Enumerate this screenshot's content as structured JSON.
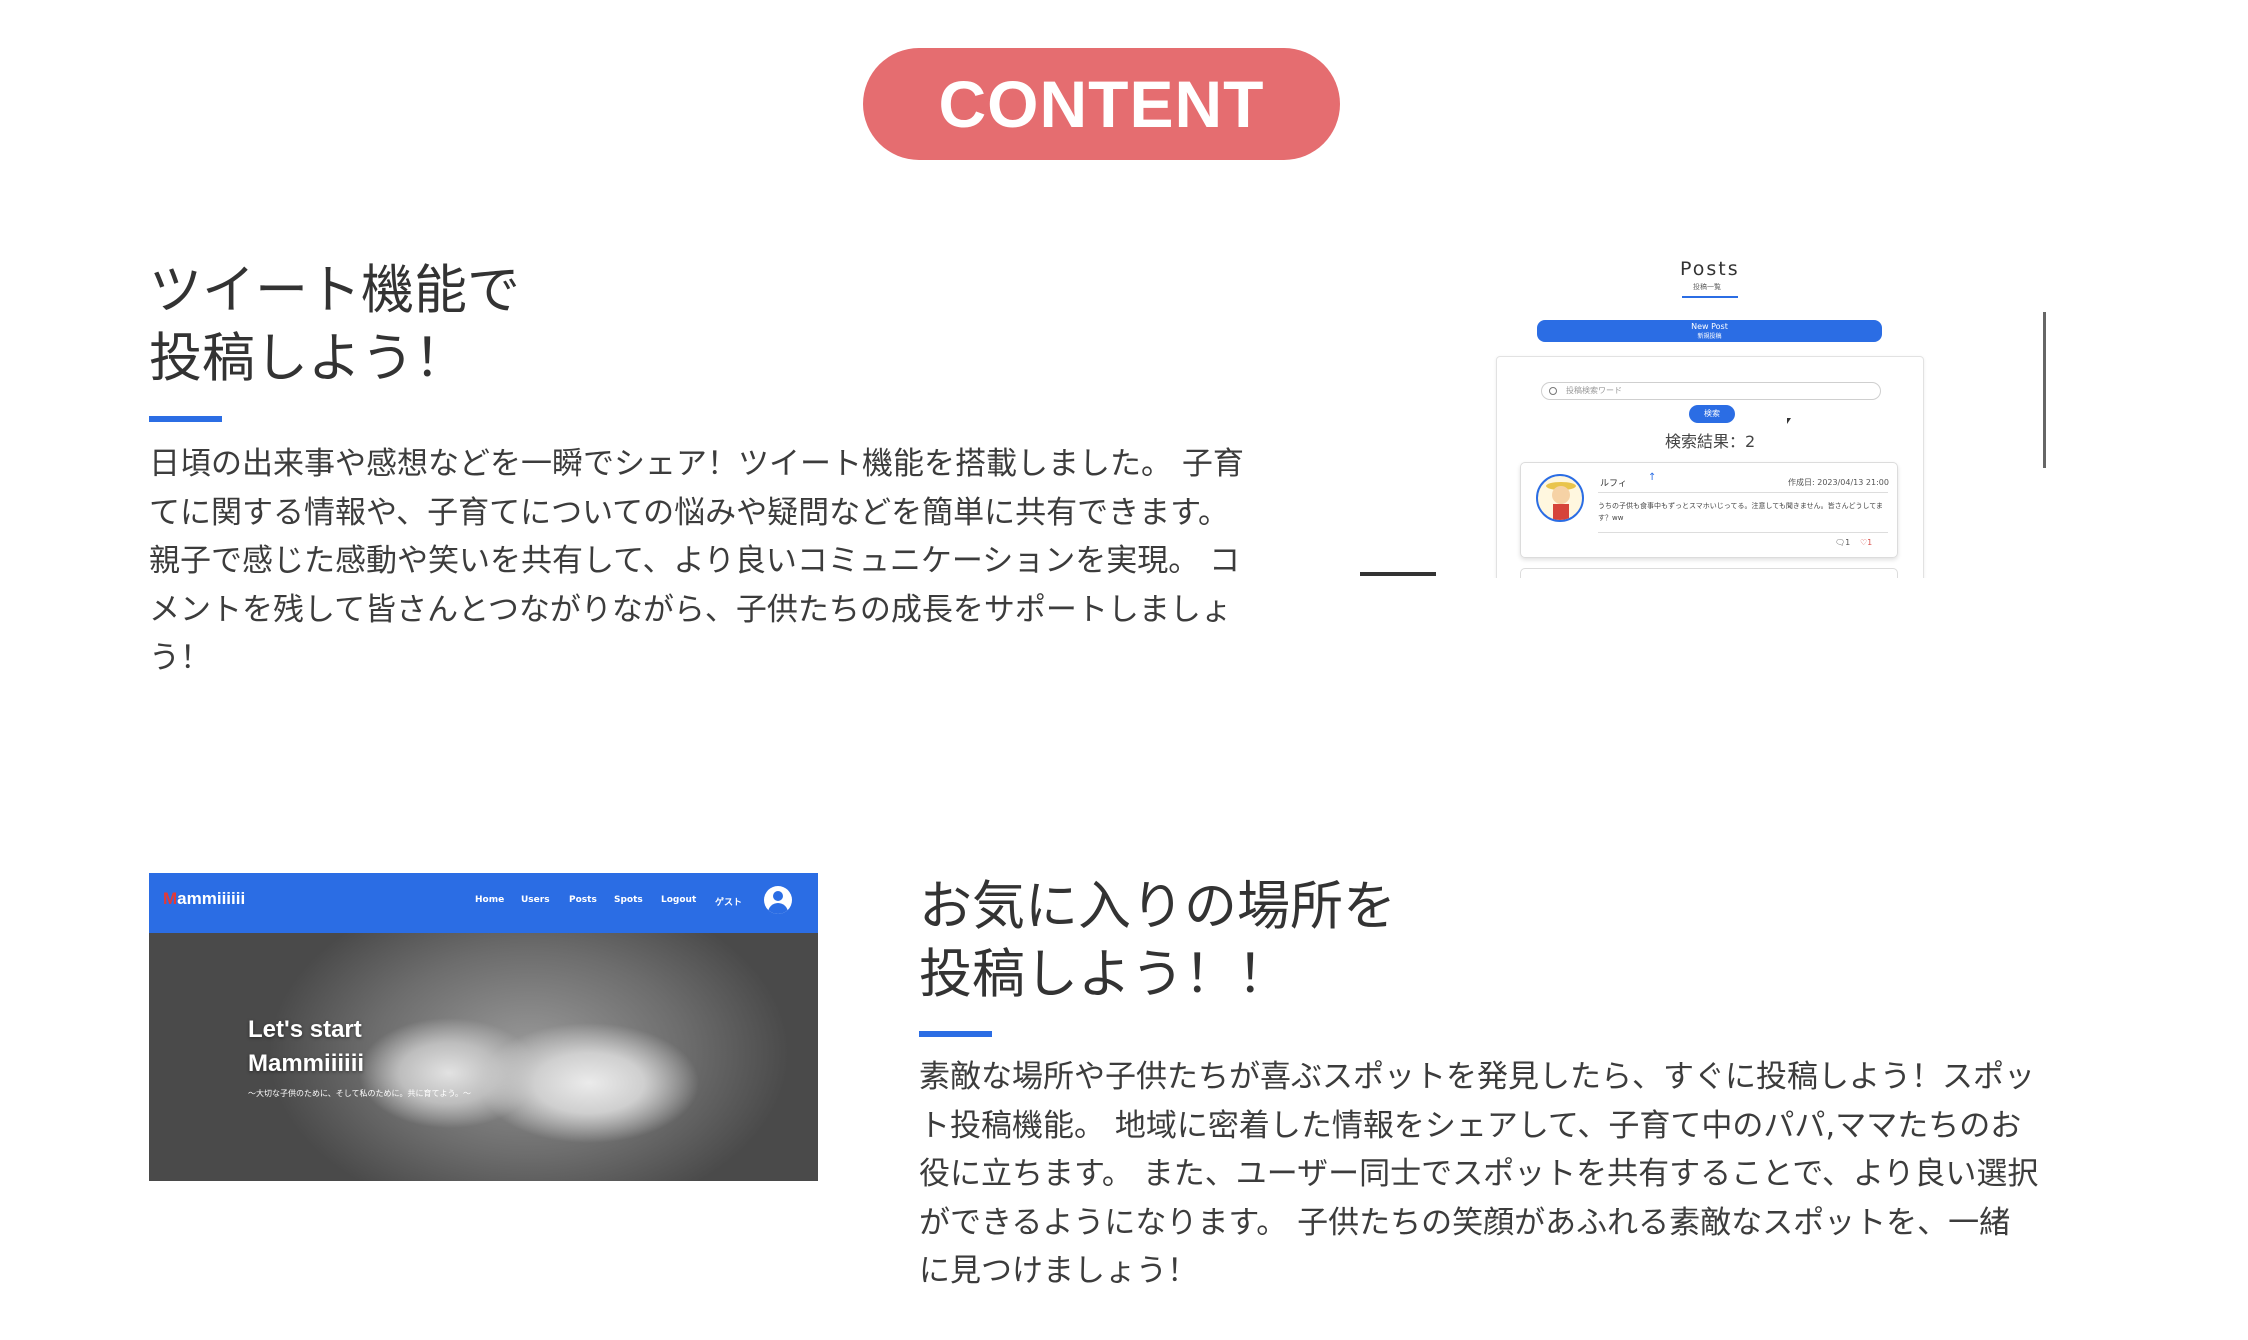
{
  "header": {
    "badge": "CONTENT"
  },
  "section1": {
    "title_line1": "ツイート機能で",
    "title_line2": "投稿しよう！",
    "description": "日頃の出来事や感想などを一瞬でシェア！ツイート機能を搭載しました。 子育てに関する情報や、子育てについての悩みや疑問などを簡単に共有できます。 親子で感じた感動や笑いを共有して、より良いコミュニケーションを実現。 コメントを残して皆さんとつながりながら、子供たちの成長をサポートしましょう！",
    "screenshot": {
      "page_title": "Posts",
      "page_subtitle": "投稿一覧",
      "new_post_label": "New Post",
      "new_post_sub": "新規投稿",
      "search_placeholder": "投稿検索ワード",
      "search_button": "検索",
      "result_text": "検索結果：2",
      "post": {
        "user": "ルフィ",
        "date": "作成日: 2023/04/13 21:00",
        "text": "うちの子供も食事中もずっとスマホいじってる。注意しても聞きません。皆さんどうしてます？ww",
        "comments": "1",
        "likes": "1"
      }
    }
  },
  "section2": {
    "title_line1": "お気に入りの場所を",
    "title_line2": "投稿しよう！！",
    "description": "素敵な場所や子供たちが喜ぶスポットを発見したら、すぐに投稿しよう！スポット投稿機能。 地域に密着した情報をシェアして、子育て中のパパ,ママたちのお役に立ちます。 また、ユーザー同士でスポットを共有することで、より良い選択ができるようになります。 子供たちの笑顔があふれる素敵なスポットを、一緒に見つけましょう！",
    "screenshot": {
      "brand_first": "M",
      "brand_rest": "ammiiiiii",
      "nav": [
        "Home",
        "Users",
        "Posts",
        "Spots",
        "Logout",
        "ゲスト"
      ],
      "hero_line1": "Let's start",
      "hero_line2": "Mammiiiiii",
      "hero_sub": "～大切な子供のために、そして私のために。共に育てよう。～"
    }
  },
  "colors": {
    "badge": "#e56d70",
    "accent": "#2b6de4",
    "text": "#333333"
  }
}
